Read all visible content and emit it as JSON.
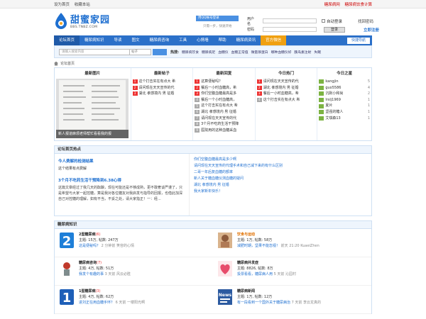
{
  "topbar": {
    "set_home": "设为首页",
    "bookmark": "收藏本站",
    "link1": "糖尿病网",
    "link2": "糖尿病饮食计算"
  },
  "logo": {
    "title": "甜蜜家园",
    "domain": "BBS.TNBZ.COM"
  },
  "login": {
    "qq_button": "用QQ帐号登录",
    "qq_sub": "只需一步，快速开始",
    "username_label": "用户名",
    "password_label": "密码",
    "auto_login": "自动登录",
    "login_button": "登录",
    "forgot_password": "找回密码",
    "register": "立即注册"
  },
  "nav": {
    "items": [
      "论坛首页",
      "糖尿病知识",
      "导读",
      "图文",
      "糖尿病咨询",
      "工具",
      "心情墙",
      "帮助",
      "糖尿病资讯",
      "官方微信"
    ],
    "quick": "快捷导航"
  },
  "search": {
    "placeholder": "请输入搜索内容",
    "type": "帖子",
    "hot_label": "热搜:",
    "hot_items": [
      "糖尿病饮食",
      "糖尿病足",
      "血糖仪",
      "血糖正常值",
      "微量尿蛋白",
      "哪种血糖仪好",
      "胰岛素注射",
      "失眠"
    ]
  },
  "breadcrumb": "论坛首页",
  "panels": {
    "pic": {
      "title": "最新图片",
      "caption": "新人报道麻烦老师帮忙看看我的报"
    },
    "new_posts": {
      "title": "最新帖子",
      "items": [
        "这个打击实在有点大 希",
        "请问现在天天宣传的代",
        "湖北 孝感境内 男 征婚"
      ]
    },
    "new_replies": {
      "title": "最新回复",
      "items": [
        "这算便秘吗？",
        "餐后一小时血糖高，希",
        "你们空腹血糖最高是多",
        "餐后一个小时血糖高，",
        "这个打击实在有点大 希",
        "湖北 孝感境内 男 征婚",
        "请问现在天天宣传的代",
        "3个月不吃药生活干预降",
        "医院用的这种血糖采血"
      ]
    },
    "hot_today": {
      "title": "今日热门",
      "items": [
        "请问现在天天宣传的代",
        "湖北 孝感境内 男 征婚",
        "餐后一小时血糖高，希",
        "这个打击实在有点大 希"
      ]
    },
    "stars": {
      "title": "今日之星",
      "items": [
        {
          "name": "kangjin",
          "count": "5"
        },
        {
          "name": "guo5586",
          "count": "4"
        },
        {
          "name": "沉默小和尚",
          "count": "2"
        },
        {
          "name": "lrslj1969",
          "count": "1"
        },
        {
          "name": "夏片",
          "count": "1"
        },
        {
          "name": "坚强的糖人",
          "count": "1"
        },
        {
          "name": "艾琪森13",
          "count": "1"
        }
      ]
    }
  },
  "hot_section": {
    "title": "论坛首页热点",
    "left_title": "今人费解的检测结果",
    "left_sub": "这个结果有点费解",
    "left_title2": "3个月不吃药生活干预降到6.38心得",
    "left_desc": "这篇文章经过了我几天的酝酿，现在可能还是不够成熟，更不敢奢谈严谨了，只是希望与大家一起控糖，算是我对各位糖友对我启发与指导的回报，也借此加深自己对控糖的理解，如有不当，不妥之处，请大家指正！一：经...",
    "right_items": [
      "你们空腹血糖最高是多少啊",
      "请问现在天天宣传的代理手术和自己减下来的有什么区别",
      "二哥一年后复血糖的额率",
      "新人关于糖血糖仪测血糖的疑问",
      "湖北 孝感境内 男 征婚",
      "我大家新年快乐！"
    ]
  },
  "forum_section": {
    "title": "糖尿病知识",
    "forums": [
      {
        "title": "2型糖尿病",
        "today": "(6)",
        "stats": "主题: 15万, 帖数: 247万",
        "last": "这是便秘吗？",
        "last_meta": "2 分钟前 笑容的心情"
      },
      {
        "title": "饮食与运动",
        "today": "",
        "stats": "主题: 1万, 帖数: 58万",
        "last": "减肥时期，坚果不能忽视！",
        "last_meta": "前天 21:20 KuaeiZhen"
      },
      {
        "title": "糖尿病咨询",
        "today": "(7)",
        "stats": "主题: 4万, 帖数: 51万",
        "last": "我发个有趣的事",
        "last_meta": "3 天前 风云必胜"
      },
      {
        "title": "糖尿病并发症",
        "today": "",
        "stats": "主题: 8826, 帖数: 8万",
        "last": "投票看看，糖尿病人用",
        "last_meta": "5 天前 沁园村"
      },
      {
        "title": "1型糖尿病",
        "today": "(3)",
        "stats": "主题: 4万, 帖数: 62万",
        "last": "进刘正在用血糖手环？",
        "last_meta": "6 天前 一楼阳光啊"
      },
      {
        "title": "糖尿病新闻",
        "today": "",
        "stats": "主题: 1万, 帖数: 12万",
        "last": "有一段看到一个国外关于糖尿病治",
        "last_meta": "7 天前 李云龙真的"
      }
    ]
  }
}
